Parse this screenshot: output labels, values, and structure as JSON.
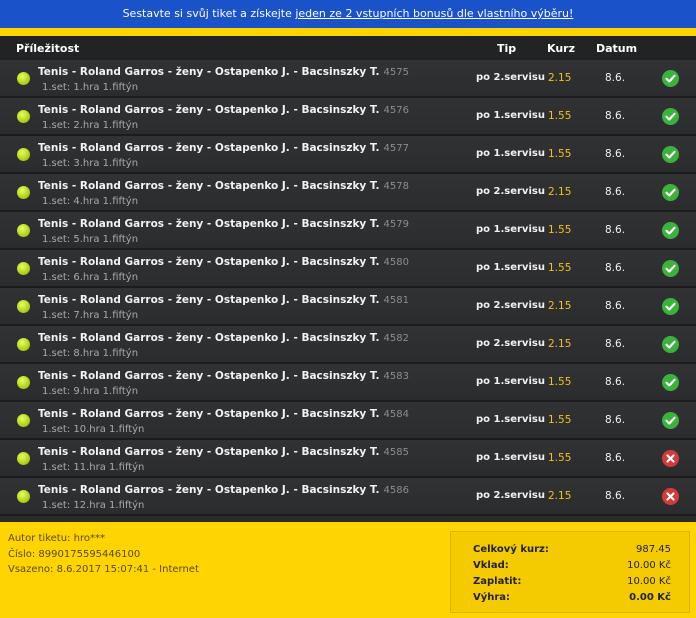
{
  "banner": {
    "text_before": "Sestavte si svůj tiket a získejte ",
    "link": "jeden ze 2 vstupních bonusů dle vlastního výběru!"
  },
  "header": {
    "event": "Příležitost",
    "tip": "Tip",
    "odds": "Kurz",
    "date": "Datum"
  },
  "rows": [
    {
      "title": "Tenis - Roland Garros - ženy - Ostapenko J. - Bacsinszky T.",
      "id": "4575",
      "sub": "1.set: 1.hra 1.fiftýn",
      "tip": "po 2.servisu",
      "odds": "2.15",
      "date": "8.6.",
      "status": "win"
    },
    {
      "title": "Tenis - Roland Garros - ženy - Ostapenko J. - Bacsinszky T.",
      "id": "4576",
      "sub": "1.set: 2.hra 1.fiftýn",
      "tip": "po 1.servisu",
      "odds": "1.55",
      "date": "8.6.",
      "status": "win"
    },
    {
      "title": "Tenis - Roland Garros - ženy - Ostapenko J. - Bacsinszky T.",
      "id": "4577",
      "sub": "1.set: 3.hra 1.fiftýn",
      "tip": "po 1.servisu",
      "odds": "1.55",
      "date": "8.6.",
      "status": "win"
    },
    {
      "title": "Tenis - Roland Garros - ženy - Ostapenko J. - Bacsinszky T.",
      "id": "4578",
      "sub": "1.set: 4.hra 1.fiftýn",
      "tip": "po 2.servisu",
      "odds": "2.15",
      "date": "8.6.",
      "status": "win"
    },
    {
      "title": "Tenis - Roland Garros - ženy - Ostapenko J. - Bacsinszky T.",
      "id": "4579",
      "sub": "1.set: 5.hra 1.fiftýn",
      "tip": "po 1.servisu",
      "odds": "1.55",
      "date": "8.6.",
      "status": "win"
    },
    {
      "title": "Tenis - Roland Garros - ženy - Ostapenko J. - Bacsinszky T.",
      "id": "4580",
      "sub": "1.set: 6.hra 1.fiftýn",
      "tip": "po 1.servisu",
      "odds": "1.55",
      "date": "8.6.",
      "status": "win"
    },
    {
      "title": "Tenis - Roland Garros - ženy - Ostapenko J. - Bacsinszky T.",
      "id": "4581",
      "sub": "1.set: 7.hra 1.fiftýn",
      "tip": "po 2.servisu",
      "odds": "2.15",
      "date": "8.6.",
      "status": "win"
    },
    {
      "title": "Tenis - Roland Garros - ženy - Ostapenko J. - Bacsinszky T.",
      "id": "4582",
      "sub": "1.set: 8.hra 1.fiftýn",
      "tip": "po 2.servisu",
      "odds": "2.15",
      "date": "8.6.",
      "status": "win"
    },
    {
      "title": "Tenis - Roland Garros - ženy - Ostapenko J. - Bacsinszky T.",
      "id": "4583",
      "sub": "1.set: 9.hra 1.fiftýn",
      "tip": "po 1.servisu",
      "odds": "1.55",
      "date": "8.6.",
      "status": "win"
    },
    {
      "title": "Tenis - Roland Garros - ženy - Ostapenko J. - Bacsinszky T.",
      "id": "4584",
      "sub": "1.set: 10.hra 1.fiftýn",
      "tip": "po 1.servisu",
      "odds": "1.55",
      "date": "8.6.",
      "status": "win"
    },
    {
      "title": "Tenis - Roland Garros - ženy - Ostapenko J. - Bacsinszky T.",
      "id": "4585",
      "sub": "1.set: 11.hra 1.fiftýn",
      "tip": "po 1.servisu",
      "odds": "1.55",
      "date": "8.6.",
      "status": "lose"
    },
    {
      "title": "Tenis - Roland Garros - ženy - Ostapenko J. - Bacsinszky T.",
      "id": "4586",
      "sub": "1.set: 12.hra 1.fiftýn",
      "tip": "po 2.servisu",
      "odds": "2.15",
      "date": "8.6.",
      "status": "lose"
    }
  ],
  "footer": {
    "author": "Autor tiketu: hro***",
    "number": "Číslo: 8990175595446100",
    "placed": "Vsazeno: 8.6.2017 15:07:41 - Internet"
  },
  "summary": {
    "total_odds_label": "Celkový kurz:",
    "total_odds": "987.45",
    "stake_label": "Vklad:",
    "stake": "10.00 Kč",
    "pay_label": "Zaplatit:",
    "pay": "10.00 Kč",
    "win_label": "Výhra:",
    "win": "0.00 Kč"
  },
  "colors": {
    "banner": "#1a52c9",
    "accent": "#ffd400",
    "odds": "#f0c21a",
    "win": "#3bb23b",
    "lose": "#d43a3a"
  }
}
